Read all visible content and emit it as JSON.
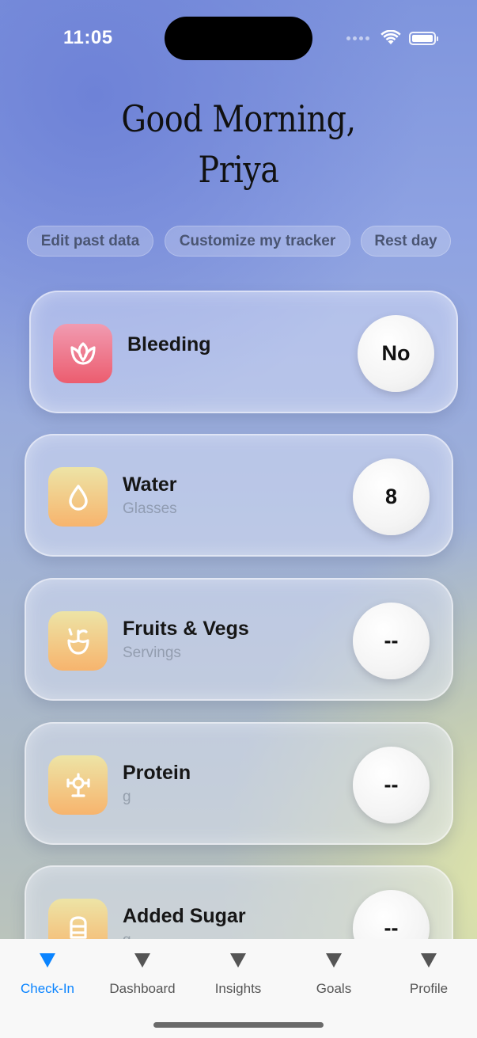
{
  "status_bar": {
    "time": "11:05"
  },
  "greeting": {
    "line1": "Good Morning,",
    "line2": "Priya"
  },
  "chips": [
    {
      "label": "Edit past data"
    },
    {
      "label": "Customize my tracker"
    },
    {
      "label": "Rest day"
    }
  ],
  "trackers": [
    {
      "title": "Bleeding",
      "subtitle": "",
      "value": "No",
      "icon": "lotus-icon"
    },
    {
      "title": "Water",
      "subtitle": "Glasses",
      "value": "8",
      "icon": "water-drop-icon"
    },
    {
      "title": "Fruits & Vegs",
      "subtitle": "Servings",
      "value": "--",
      "icon": "fruit-icon"
    },
    {
      "title": "Protein",
      "subtitle": "g",
      "value": "--",
      "icon": "protein-icon"
    },
    {
      "title": "Added Sugar",
      "subtitle": "g",
      "value": "--",
      "icon": "sugar-icon"
    }
  ],
  "tabs": [
    {
      "label": "Check-In",
      "active": true
    },
    {
      "label": "Dashboard",
      "active": false
    },
    {
      "label": "Insights",
      "active": false
    },
    {
      "label": "Goals",
      "active": false
    },
    {
      "label": "Profile",
      "active": false
    }
  ],
  "colors": {
    "accent": "#0a84ff",
    "icon_red": "#ec5d6f",
    "icon_orange": "#f7b46d"
  }
}
